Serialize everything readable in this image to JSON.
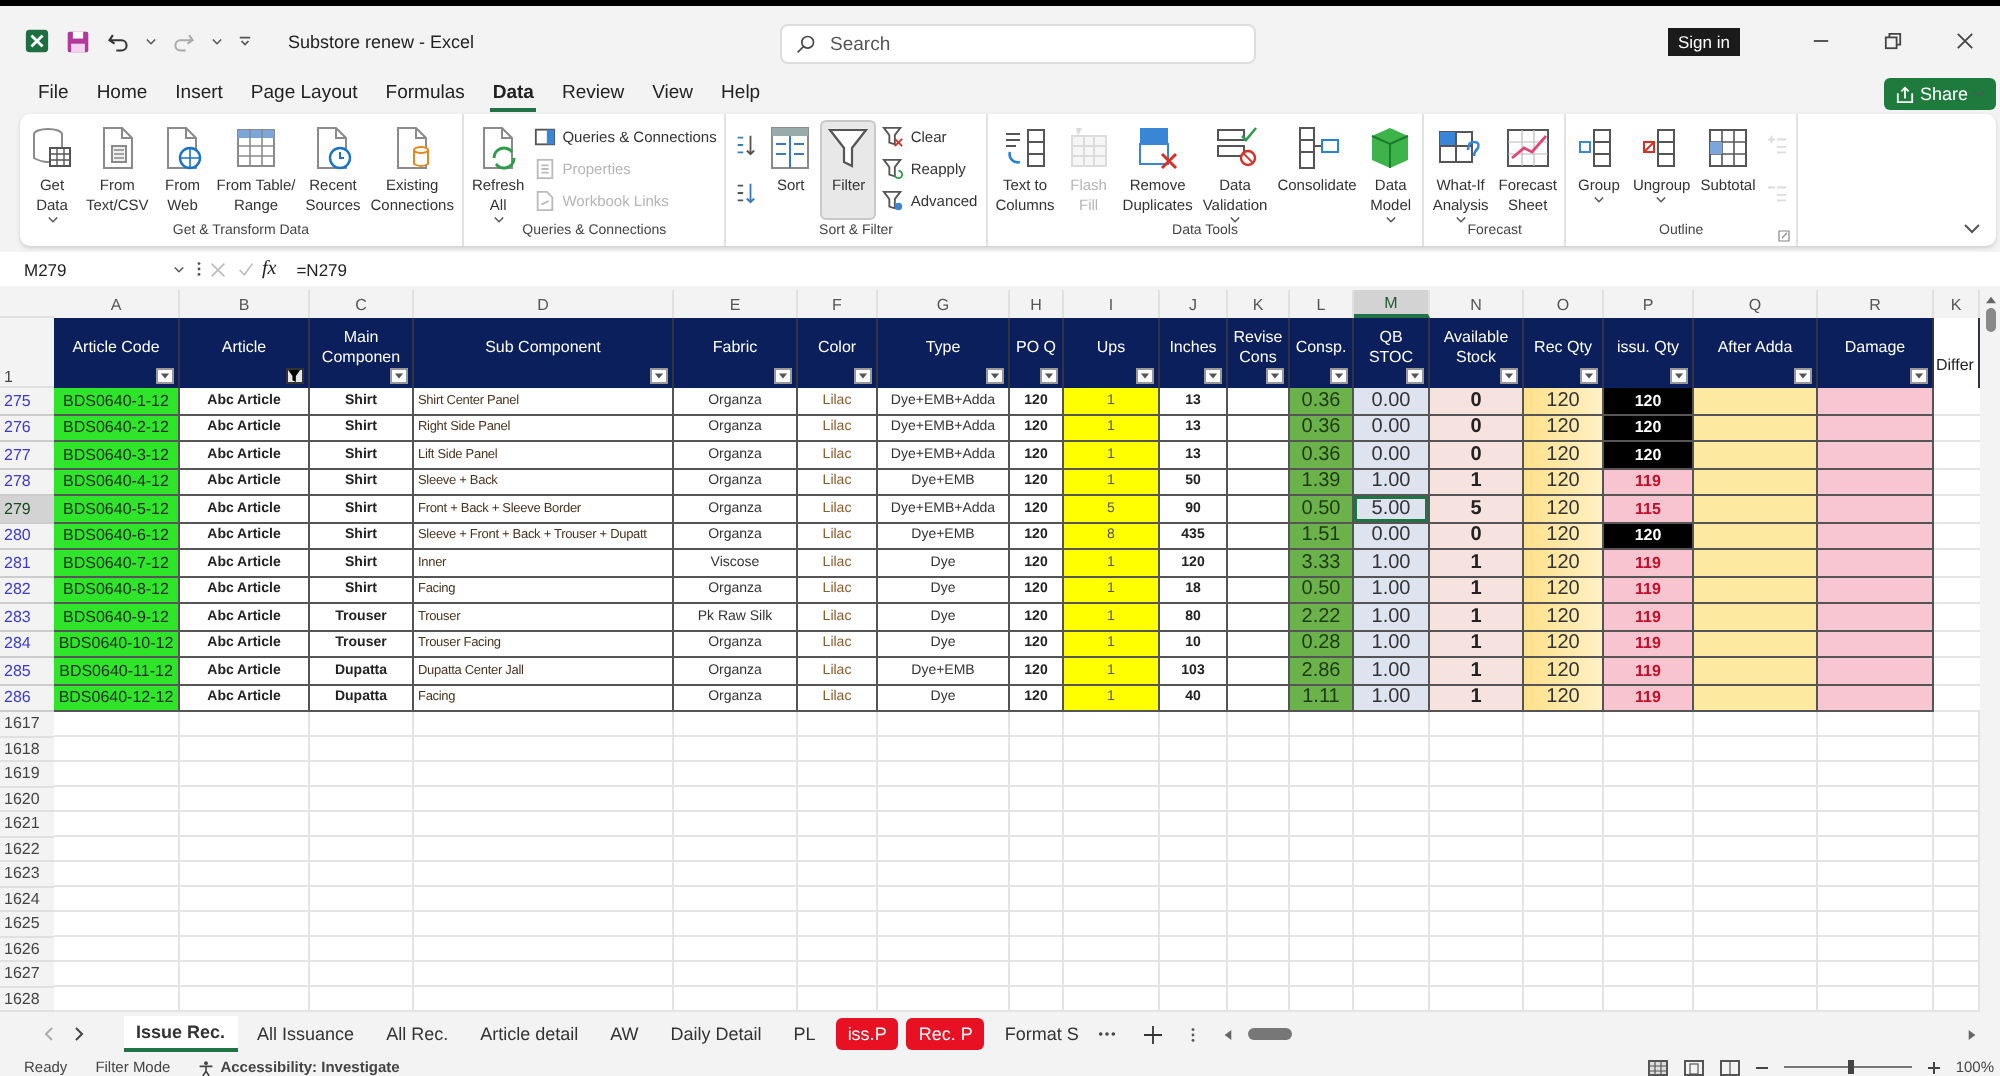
{
  "window": {
    "title": "Substore renew  -  Excel",
    "search_placeholder": "Search",
    "sign_in": "Sign in"
  },
  "menu_tabs": [
    {
      "label": "File",
      "selected": false
    },
    {
      "label": "Home",
      "selected": false
    },
    {
      "label": "Insert",
      "selected": false
    },
    {
      "label": "Page Layout",
      "selected": false
    },
    {
      "label": "Formulas",
      "selected": false
    },
    {
      "label": "Data",
      "selected": true
    },
    {
      "label": "Review",
      "selected": false
    },
    {
      "label": "View",
      "selected": false
    },
    {
      "label": "Help",
      "selected": false
    }
  ],
  "share": "Share",
  "ribbon_groups": [
    {
      "label": "Get & Transform Data",
      "commands": [
        {
          "kind": "large",
          "lines": [
            "Get",
            "Data"
          ],
          "dropdown": true,
          "disabled": false,
          "selected": false
        },
        {
          "kind": "large",
          "lines": [
            "From",
            "Text/CSV"
          ],
          "dropdown": false,
          "disabled": false,
          "selected": false
        },
        {
          "kind": "large",
          "lines": [
            "From",
            "Web"
          ],
          "dropdown": false,
          "disabled": false,
          "selected": false
        },
        {
          "kind": "large",
          "lines": [
            "From Table/",
            "Range"
          ],
          "dropdown": false,
          "disabled": false,
          "selected": false
        },
        {
          "kind": "large",
          "lines": [
            "Recent",
            "Sources"
          ],
          "dropdown": false,
          "disabled": false,
          "selected": false
        },
        {
          "kind": "large",
          "lines": [
            "Existing",
            "Connections"
          ],
          "dropdown": false,
          "disabled": false,
          "selected": false
        }
      ]
    },
    {
      "label": "Queries & Connections",
      "commands": [
        {
          "kind": "large",
          "lines": [
            "Refresh",
            "All"
          ],
          "dropdown": true,
          "disabled": false,
          "selected": false
        },
        {
          "kind": "small",
          "lines": [
            "Queries & Connections"
          ],
          "disabled": false
        },
        {
          "kind": "small",
          "lines": [
            "Properties"
          ],
          "disabled": true
        },
        {
          "kind": "small",
          "lines": [
            "Workbook Links"
          ],
          "disabled": true
        }
      ]
    },
    {
      "label": "Sort & Filter",
      "commands": [
        {
          "kind": "icon",
          "disabled": false
        },
        {
          "kind": "icon",
          "disabled": false
        },
        {
          "kind": "large",
          "lines": [
            "Sort"
          ],
          "dropdown": false,
          "disabled": false,
          "selected": false
        },
        {
          "kind": "large",
          "lines": [
            "Filter"
          ],
          "dropdown": false,
          "disabled": false,
          "selected": true
        },
        {
          "kind": "small",
          "lines": [
            "Clear"
          ],
          "disabled": false
        },
        {
          "kind": "small",
          "lines": [
            "Reapply"
          ],
          "disabled": false
        },
        {
          "kind": "small",
          "lines": [
            "Advanced"
          ],
          "disabled": false
        }
      ]
    },
    {
      "label": "Data Tools",
      "commands": [
        {
          "kind": "large",
          "lines": [
            "Text to",
            "Columns"
          ],
          "dropdown": false,
          "disabled": false,
          "selected": false
        },
        {
          "kind": "large",
          "lines": [
            "Flash",
            "Fill"
          ],
          "dropdown": false,
          "disabled": true,
          "selected": false
        },
        {
          "kind": "large",
          "lines": [
            "Remove",
            "Duplicates"
          ],
          "dropdown": false,
          "disabled": false,
          "selected": false
        },
        {
          "kind": "large",
          "lines": [
            "Data",
            "Validation"
          ],
          "dropdown": true,
          "disabled": false,
          "selected": false
        },
        {
          "kind": "large",
          "lines": [
            "Consolidate"
          ],
          "dropdown": false,
          "disabled": false,
          "selected": false
        },
        {
          "kind": "large",
          "lines": [
            "Data",
            "Model"
          ],
          "dropdown": true,
          "disabled": false,
          "selected": false
        }
      ]
    },
    {
      "label": "Forecast",
      "commands": [
        {
          "kind": "large",
          "lines": [
            "What-If",
            "Analysis"
          ],
          "dropdown": true,
          "disabled": false,
          "selected": false
        },
        {
          "kind": "large",
          "lines": [
            "Forecast",
            "Sheet"
          ],
          "dropdown": false,
          "disabled": false,
          "selected": false
        }
      ]
    },
    {
      "label": "Outline",
      "commands": [
        {
          "kind": "large",
          "lines": [
            "Group"
          ],
          "dropdown": true,
          "disabled": false,
          "selected": false
        },
        {
          "kind": "large",
          "lines": [
            "Ungroup"
          ],
          "dropdown": true,
          "disabled": false,
          "selected": false
        },
        {
          "kind": "large",
          "lines": [
            "Subtotal"
          ],
          "dropdown": false,
          "disabled": false,
          "selected": false
        },
        {
          "kind": "icon",
          "disabled": true
        },
        {
          "kind": "icon",
          "disabled": true
        }
      ]
    }
  ],
  "formula_bar": {
    "name_box": "M279",
    "function_label": "fx",
    "formula": "=N279"
  },
  "columns": [
    {
      "letter": "A",
      "header": "Article Code",
      "kind": "filter",
      "filtered": false,
      "selected": false
    },
    {
      "letter": "B",
      "header": "Article",
      "kind": "filter",
      "filtered": true,
      "selected": false
    },
    {
      "letter": "C",
      "header": "Main Componen",
      "kind": "filter",
      "filtered": false,
      "selected": false
    },
    {
      "letter": "D",
      "header": "Sub Component",
      "kind": "filter",
      "filtered": false,
      "selected": false
    },
    {
      "letter": "E",
      "header": "Fabric",
      "kind": "filter",
      "filtered": false,
      "selected": false
    },
    {
      "letter": "F",
      "header": "Color",
      "kind": "filter",
      "filtered": false,
      "selected": false
    },
    {
      "letter": "G",
      "header": "Type",
      "kind": "filter",
      "filtered": false,
      "selected": false
    },
    {
      "letter": "H",
      "header": "PO Q",
      "kind": "filter",
      "filtered": false,
      "selected": false
    },
    {
      "letter": "I",
      "header": "Ups",
      "kind": "filter",
      "filtered": false,
      "selected": false
    },
    {
      "letter": "J",
      "header": "Inches",
      "kind": "filter",
      "filtered": false,
      "selected": false
    },
    {
      "letter": "K",
      "header": "Revise Cons",
      "kind": "filter",
      "filtered": false,
      "selected": false
    },
    {
      "letter": "L",
      "header": "Consp.",
      "kind": "filter",
      "filtered": false,
      "selected": false
    },
    {
      "letter": "M",
      "header": "QB STOC",
      "kind": "filter",
      "filtered": false,
      "selected": true
    },
    {
      "letter": "N",
      "header": "Available Stock",
      "kind": "filter",
      "filtered": false,
      "selected": false
    },
    {
      "letter": "O",
      "header": "Rec Qty",
      "kind": "filter",
      "filtered": false,
      "selected": false
    },
    {
      "letter": "P",
      "header": "issu. Qty",
      "kind": "filter",
      "filtered": false,
      "selected": false
    },
    {
      "letter": "Q",
      "header": "After Adda",
      "kind": "filter",
      "filtered": false,
      "selected": false
    },
    {
      "letter": "R",
      "header": "Damage",
      "kind": "filter",
      "filtered": false,
      "selected": false
    },
    {
      "letter": "K",
      "header": "Differ",
      "kind": "plain",
      "selected": false
    }
  ],
  "header_row_number": "1",
  "rows": [
    {
      "number": "275",
      "selected": false,
      "article_code": "BDS0640-1-12",
      "article": "Abc Article",
      "main_component": "Shirt",
      "sub_component": "Shirt Center Panel",
      "fabric": "Organza",
      "shade": "Lilac",
      "type": "Dye+EMB+Adda",
      "po_qty": "120",
      "ups": "1",
      "inches": "13",
      "consp": "0.36",
      "qb_stock": "0.00",
      "available_stock": "0",
      "rec_qty": "120",
      "issu_qty": "120",
      "issued_in_full": true
    },
    {
      "number": "276",
      "selected": false,
      "article_code": "BDS0640-2-12",
      "article": "Abc Article",
      "main_component": "Shirt",
      "sub_component": "Right Side Panel",
      "fabric": "Organza",
      "shade": "Lilac",
      "type": "Dye+EMB+Adda",
      "po_qty": "120",
      "ups": "1",
      "inches": "13",
      "consp": "0.36",
      "qb_stock": "0.00",
      "available_stock": "0",
      "rec_qty": "120",
      "issu_qty": "120",
      "issued_in_full": true
    },
    {
      "number": "277",
      "selected": false,
      "article_code": "BDS0640-3-12",
      "article": "Abc Article",
      "main_component": "Shirt",
      "sub_component": "Lift Side Panel",
      "fabric": "Organza",
      "shade": "Lilac",
      "type": "Dye+EMB+Adda",
      "po_qty": "120",
      "ups": "1",
      "inches": "13",
      "consp": "0.36",
      "qb_stock": "0.00",
      "available_stock": "0",
      "rec_qty": "120",
      "issu_qty": "120",
      "issued_in_full": true
    },
    {
      "number": "278",
      "selected": false,
      "article_code": "BDS0640-4-12",
      "article": "Abc Article",
      "main_component": "Shirt",
      "sub_component": "Sleeve + Back",
      "fabric": "Organza",
      "shade": "Lilac",
      "type": "Dye+EMB",
      "po_qty": "120",
      "ups": "1",
      "inches": "50",
      "consp": "1.39",
      "qb_stock": "1.00",
      "available_stock": "1",
      "rec_qty": "120",
      "issu_qty": "119",
      "issued_in_full": false
    },
    {
      "number": "279",
      "selected": true,
      "article_code": "BDS0640-5-12",
      "article": "Abc Article",
      "main_component": "Shirt",
      "sub_component": "Front + Back + Sleeve Border",
      "fabric": "Organza",
      "shade": "Lilac",
      "type": "Dye+EMB+Adda",
      "po_qty": "120",
      "ups": "5",
      "inches": "90",
      "consp": "0.50",
      "qb_stock": "5.00",
      "available_stock": "5",
      "rec_qty": "120",
      "issu_qty": "115",
      "issued_in_full": false
    },
    {
      "number": "280",
      "selected": false,
      "article_code": "BDS0640-6-12",
      "article": "Abc Article",
      "main_component": "Shirt",
      "sub_component": "Sleeve + Front + Back + Trouser + Dupatt",
      "fabric": "Organza",
      "shade": "Lilac",
      "type": "Dye+EMB",
      "po_qty": "120",
      "ups": "8",
      "inches": "435",
      "consp": "1.51",
      "qb_stock": "0.00",
      "available_stock": "0",
      "rec_qty": "120",
      "issu_qty": "120",
      "issued_in_full": true
    },
    {
      "number": "281",
      "selected": false,
      "article_code": "BDS0640-7-12",
      "article": "Abc Article",
      "main_component": "Shirt",
      "sub_component": "Inner",
      "fabric": "Viscose",
      "shade": "Lilac",
      "type": "Dye",
      "po_qty": "120",
      "ups": "1",
      "inches": "120",
      "consp": "3.33",
      "qb_stock": "1.00",
      "available_stock": "1",
      "rec_qty": "120",
      "issu_qty": "119",
      "issued_in_full": false
    },
    {
      "number": "282",
      "selected": false,
      "article_code": "BDS0640-8-12",
      "article": "Abc Article",
      "main_component": "Shirt",
      "sub_component": "Facing",
      "fabric": "Organza",
      "shade": "Lilac",
      "type": "Dye",
      "po_qty": "120",
      "ups": "1",
      "inches": "18",
      "consp": "0.50",
      "qb_stock": "1.00",
      "available_stock": "1",
      "rec_qty": "120",
      "issu_qty": "119",
      "issued_in_full": false
    },
    {
      "number": "283",
      "selected": false,
      "article_code": "BDS0640-9-12",
      "article": "Abc Article",
      "main_component": "Trouser",
      "sub_component": "Trouser",
      "fabric": "Pk Raw Silk",
      "shade": "Lilac",
      "type": "Dye",
      "po_qty": "120",
      "ups": "1",
      "inches": "80",
      "consp": "2.22",
      "qb_stock": "1.00",
      "available_stock": "1",
      "rec_qty": "120",
      "issu_qty": "119",
      "issued_in_full": false
    },
    {
      "number": "284",
      "selected": false,
      "article_code": "BDS0640-10-12",
      "article": "Abc Article",
      "main_component": "Trouser",
      "sub_component": "Trouser Facing",
      "fabric": "Organza",
      "shade": "Lilac",
      "type": "Dye",
      "po_qty": "120",
      "ups": "1",
      "inches": "10",
      "consp": "0.28",
      "qb_stock": "1.00",
      "available_stock": "1",
      "rec_qty": "120",
      "issu_qty": "119",
      "issued_in_full": false
    },
    {
      "number": "285",
      "selected": false,
      "article_code": "BDS0640-11-12",
      "article": "Abc Article",
      "main_component": "Dupatta",
      "sub_component": "Dupatta Center Jall",
      "fabric": "Organza",
      "shade": "Lilac",
      "type": "Dye+EMB",
      "po_qty": "120",
      "ups": "1",
      "inches": "103",
      "consp": "2.86",
      "qb_stock": "1.00",
      "available_stock": "1",
      "rec_qty": "120",
      "issu_qty": "119",
      "issued_in_full": false
    },
    {
      "number": "286",
      "selected": false,
      "article_code": "BDS0640-12-12",
      "article": "Abc Article",
      "main_component": "Dupatta",
      "sub_component": "Facing",
      "fabric": "Organza",
      "shade": "Lilac",
      "type": "Dye",
      "po_qty": "120",
      "ups": "1",
      "inches": "40",
      "consp": "1.11",
      "qb_stock": "1.00",
      "available_stock": "1",
      "rec_qty": "120",
      "issu_qty": "119",
      "issued_in_full": false
    }
  ],
  "empty_rows": [
    "1617",
    "1618",
    "1619",
    "1620",
    "1621",
    "1622",
    "1623",
    "1624",
    "1625",
    "1626",
    "1627",
    "1628"
  ],
  "sheet_tabs": [
    {
      "label": "Issue Rec.",
      "selected": true
    },
    {
      "label": "All Issuance",
      "selected": false
    },
    {
      "label": "All Rec.",
      "selected": false
    },
    {
      "label": "Article detail",
      "selected": false
    },
    {
      "label": "AW",
      "selected": false
    },
    {
      "label": "Daily Detail",
      "selected": false
    },
    {
      "label": "PL",
      "selected": false
    },
    {
      "label": "iss.P",
      "selected": false,
      "color": "#e81123"
    },
    {
      "label": "Rec. P",
      "selected": false,
      "color": "#e81123"
    },
    {
      "label": "Format S",
      "selected": false
    }
  ],
  "status_bar": {
    "ready": "Ready",
    "filter_mode": "Filter Mode",
    "accessibility": "Accessibility: Investigate",
    "zoom": "100%",
    "zoom_slider": {
      "level": 0.5
    }
  }
}
